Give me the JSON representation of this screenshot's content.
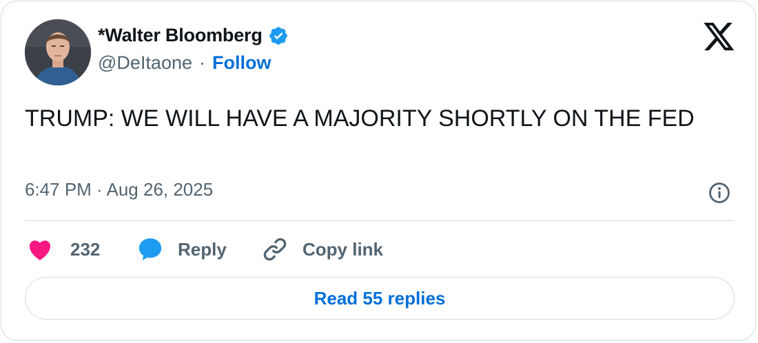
{
  "author": {
    "display_name": "*Walter Bloomberg",
    "handle": "@DeItaone",
    "separator": "·",
    "follow_label": "Follow",
    "verified_color": "#1d9bf0"
  },
  "tweet": {
    "text": "TRUMP: WE WILL HAVE A MAJORITY SHORTLY ON THE FED",
    "timestamp": "6:47 PM · Aug 26, 2025"
  },
  "actions": {
    "like_count": "232",
    "reply_label": "Reply",
    "copy_label": "Copy link"
  },
  "read_replies_label": "Read 55 replies",
  "icons": {
    "brand": "x-logo-icon",
    "info": "info-icon",
    "like": "heart-icon",
    "reply": "speech-bubble-icon",
    "copy": "link-icon"
  },
  "colors": {
    "like": "#f91880",
    "reply": "#1d9bf0",
    "link": "#006fd6",
    "muted": "#536471",
    "text": "#0f1419"
  }
}
